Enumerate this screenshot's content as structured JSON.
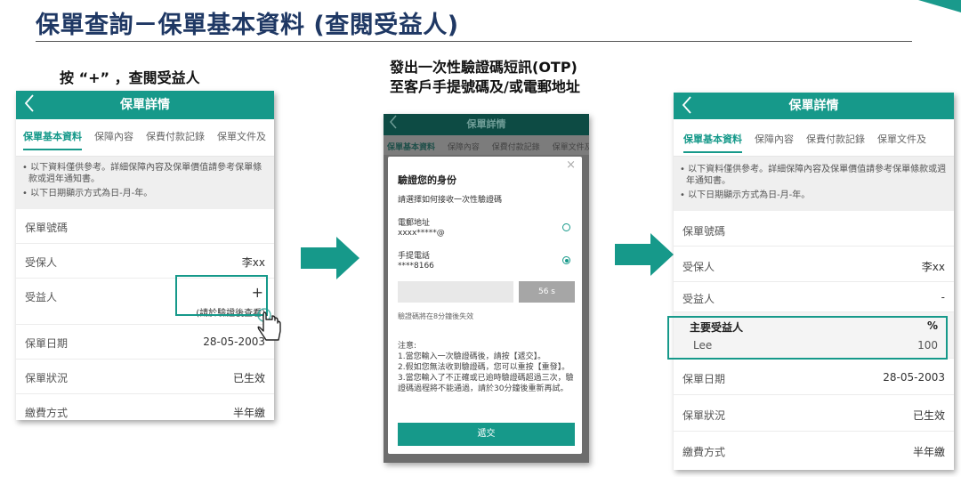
{
  "title": "保單查詢－保單基本資料 (查閱受益人)",
  "captions": {
    "step1": "按 “+” ，查閱受益人",
    "step2_line1": "發出一次性驗證碼短訊(OTP)",
    "step2_line2": "至客戶手提號碼及/或電郵地址"
  },
  "colors": {
    "brand": "#16998a",
    "title": "#1f3864"
  },
  "header": {
    "back_icon": "chevron-left-icon",
    "title": "保單詳情"
  },
  "tabs": [
    "保單基本資料",
    "保障內容",
    "保費付款記錄",
    "保單文件及"
  ],
  "notes": [
    "以下資料僅供參考。詳細保障內容及保單價值請參考保單條款或週年通知書。",
    "以下日期顯示方式為日-月-年。"
  ],
  "fields": {
    "policy_no": {
      "label": "保單號碼",
      "value": ""
    },
    "insured": {
      "label": "受保人",
      "value": "李xx"
    },
    "beneficiary": {
      "label": "受益人",
      "plus": "+",
      "hint": "(請於驗證後查看)",
      "value": "-"
    },
    "policy_date": {
      "label": "保單日期",
      "value": "28-05-2003"
    },
    "status": {
      "label": "保單狀況",
      "value": "已生效"
    },
    "pay_mode": {
      "label": "繳費方式",
      "value": "半年繳"
    }
  },
  "beneficiary_table": {
    "col_name": "主要受益人",
    "col_pct": "%",
    "name": "Lee",
    "pct": "100"
  },
  "otp_modal": {
    "close_icon": "close-icon",
    "title": "驗證您的身份",
    "subtitle": "請選擇如何接收一次性驗證碼",
    "email_label": "電郵地址",
    "email_value": "xxxx*****@",
    "phone_label": "手提電話",
    "phone_value": "****8166",
    "resend": "56 s",
    "expire": "驗證碼將在8分鐘後失效",
    "notice_title": "注意:",
    "notice_1": "1.當您輸入一次驗證碼後，請按【遞交】。",
    "notice_2": "2.假如您無法收到驗證碼，您可以重按【重發】。",
    "notice_3": "3.當您輸入了不正確或已逾時驗證碼超過三次，驗證碼過程將不能通過，請於30分鐘後重新再試。",
    "submit": "遞交"
  }
}
